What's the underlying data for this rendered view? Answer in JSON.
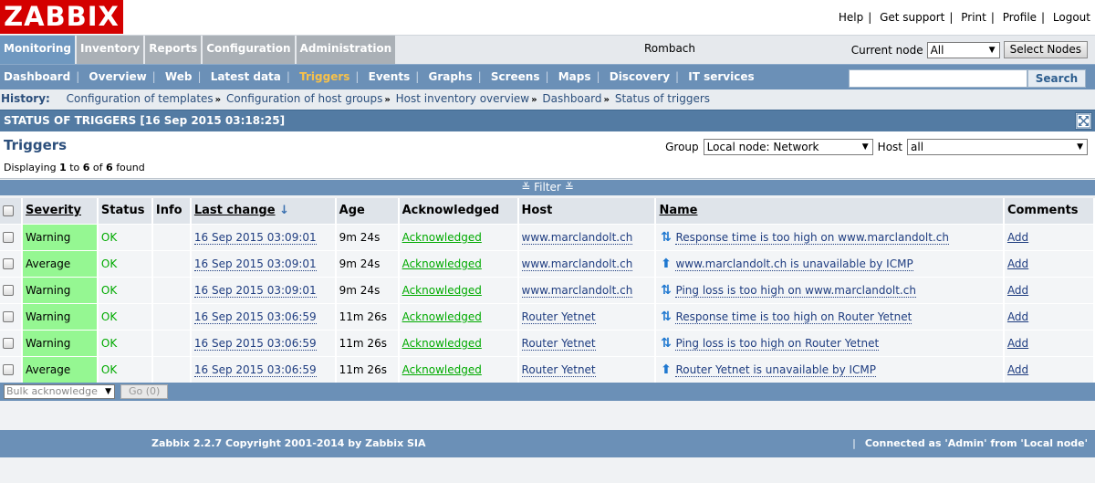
{
  "header": {
    "logo": "ZABBIX",
    "links": [
      "Help",
      "Get support",
      "Print",
      "Profile",
      "Logout"
    ]
  },
  "mainmenu": {
    "tabs": [
      "Monitoring",
      "Inventory",
      "Reports",
      "Configuration",
      "Administration"
    ],
    "active": "Monitoring",
    "node_name": "Rombach",
    "current_node_label": "Current node",
    "current_node_value": "All",
    "select_nodes_label": "Select Nodes"
  },
  "submenu": {
    "items": [
      "Dashboard",
      "Overview",
      "Web",
      "Latest data",
      "Triggers",
      "Events",
      "Graphs",
      "Screens",
      "Maps",
      "Discovery",
      "IT services"
    ],
    "active": "Triggers",
    "search_button": "Search"
  },
  "history": {
    "label": "History:",
    "items": [
      "Configuration of templates",
      "Configuration of host groups",
      "Host inventory overview",
      "Dashboard",
      "Status of triggers"
    ]
  },
  "page": {
    "title": "STATUS OF TRIGGERS [16 Sep 2015 03:18:25]",
    "heading": "Triggers",
    "displaying_prefix": "Displaying",
    "displaying_from": "1",
    "displaying_to_word": "to",
    "displaying_to": "6",
    "displaying_of_word": "of",
    "displaying_total": "6",
    "displaying_suffix": "found",
    "group_label": "Group",
    "group_value": "Local node: Network",
    "host_label": "Host",
    "host_value": "all",
    "filter_label": "Filter"
  },
  "table": {
    "columns": [
      "Severity",
      "Status",
      "Info",
      "Last change",
      "Age",
      "Acknowledged",
      "Host",
      "Name",
      "Comments"
    ],
    "rows": [
      {
        "severity": "Warning",
        "status": "OK",
        "last_change": "16 Sep 2015 03:09:01",
        "age": "9m 24s",
        "ack": "Acknowledged",
        "host": "www.marclandolt.ch",
        "dep": "both",
        "name": "Response time is too high on www.marclandolt.ch",
        "comments": "Add"
      },
      {
        "severity": "Average",
        "status": "OK",
        "last_change": "16 Sep 2015 03:09:01",
        "age": "9m 24s",
        "ack": "Acknowledged",
        "host": "www.marclandolt.ch",
        "dep": "up",
        "name": "www.marclandolt.ch is unavailable by ICMP",
        "comments": "Add"
      },
      {
        "severity": "Warning",
        "status": "OK",
        "last_change": "16 Sep 2015 03:09:01",
        "age": "9m 24s",
        "ack": "Acknowledged",
        "host": "www.marclandolt.ch",
        "dep": "both",
        "name": "Ping loss is too high on www.marclandolt.ch",
        "comments": "Add"
      },
      {
        "severity": "Warning",
        "status": "OK",
        "last_change": "16 Sep 2015 03:06:59",
        "age": "11m 26s",
        "ack": "Acknowledged",
        "host": "Router Yetnet",
        "dep": "both",
        "name": "Response time is too high on Router Yetnet",
        "comments": "Add"
      },
      {
        "severity": "Warning",
        "status": "OK",
        "last_change": "16 Sep 2015 03:06:59",
        "age": "11m 26s",
        "ack": "Acknowledged",
        "host": "Router Yetnet",
        "dep": "both",
        "name": "Ping loss is too high on Router Yetnet",
        "comments": "Add"
      },
      {
        "severity": "Average",
        "status": "OK",
        "last_change": "16 Sep 2015 03:06:59",
        "age": "11m 26s",
        "ack": "Acknowledged",
        "host": "Router Yetnet",
        "dep": "up",
        "name": "Router Yetnet is unavailable by ICMP",
        "comments": "Add"
      }
    ],
    "bulk_label": "Bulk acknowledge",
    "go_label": "Go (0)"
  },
  "footer": {
    "copyright": "Zabbix 2.2.7 Copyright 2001-2014 by Zabbix SIA",
    "connected": "Connected as 'Admin' from 'Local node'"
  },
  "colors": {
    "logo_red": "#d40000",
    "active_tab": "#6f98c0",
    "severity_bg": "#95f792",
    "ok_green": "#00aa00",
    "submenu_active": "#f7c14a"
  }
}
